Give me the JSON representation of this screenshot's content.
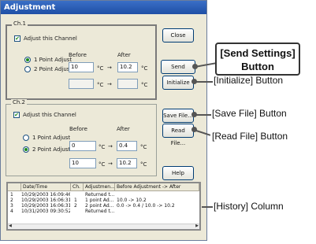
{
  "window": {
    "title": "Adjustment"
  },
  "ch1": {
    "legend": "Ch.1",
    "adjust_label": "Adjust this Channel",
    "adjust_checked": true,
    "mode1_label": "1 Point Adjust",
    "mode2_label": "2 Point Adjust",
    "selected_mode": "1 Point Adjust",
    "before_label": "Before",
    "after_label": "After",
    "before1": "10",
    "after1": "10.2",
    "before2": "",
    "after2": "",
    "unit": "°C",
    "arrow": "→"
  },
  "ch2": {
    "legend": "Ch.2",
    "adjust_label": "Adjust this Channel",
    "adjust_checked": true,
    "mode1_label": "1 Point Adjust",
    "mode2_label": "2 Point Adjust",
    "selected_mode": "2 Point Adjust",
    "before_label": "Before",
    "after_label": "After",
    "before1": "0",
    "after1": "0.4",
    "before2": "10",
    "after2": "10.2",
    "unit": "°C",
    "arrow": "→"
  },
  "buttons": {
    "close": "Close",
    "send": "Send Setting",
    "init": "Initialize",
    "save": "Save File...",
    "read": "Read File...",
    "help": "Help"
  },
  "history": {
    "columns": [
      "",
      "Date/Time",
      "Ch.",
      "Adjustmen...",
      "Before Adjustment -> After"
    ],
    "rows": [
      [
        "1",
        "10/29/2003 16:09:46",
        "",
        "Returned t...",
        ""
      ],
      [
        "2",
        "10/29/2003 16:06:31",
        "1",
        "1 point Ad...",
        "10.0 -> 10.2"
      ],
      [
        "3",
        "10/29/2003 16:06:31",
        "2",
        "2 point Ad...",
        "0.0 -> 0.4 / 10.0 -> 10.2"
      ],
      [
        "4",
        "10/31/2003 09:30:52",
        "",
        "Returned t...",
        ""
      ]
    ]
  },
  "callouts": {
    "send": "[Send Settings]\nButton",
    "init": "[Initialize] Button",
    "save": "[Save File] Button",
    "read": "[Read File] Button",
    "history": "[History] Column"
  }
}
